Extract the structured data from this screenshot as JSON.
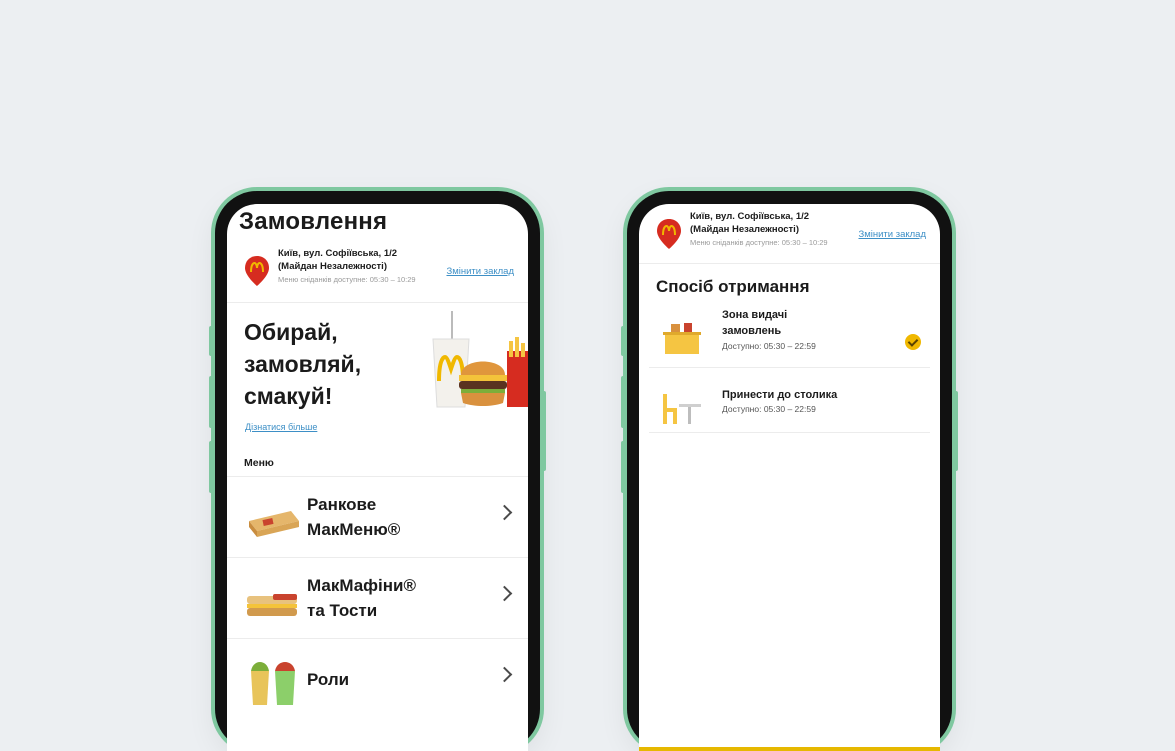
{
  "left_screen": {
    "title": "Замовлення",
    "store": {
      "name": "Київ, вул. Софіївська, 1/2 (Майдан Незалежності)",
      "note": "Меню сніданків доступне: 05:30 – 10:29",
      "change_link": "Змінити заклад"
    },
    "hero": {
      "line1": "Обирай,",
      "line2": "замовляй,",
      "line3": "смакуй!"
    },
    "learn_more": "Дізнатися більше",
    "menu_label": "Меню",
    "menu_items": [
      {
        "line1": "Ранкове",
        "line2": "МакМеню®",
        "icon": "breakfast-sandwich-icon"
      },
      {
        "line1": "МакМафіни®",
        "line2": "та Тости",
        "icon": "muffin-toast-icon"
      },
      {
        "line1": "Роли",
        "line2": "",
        "icon": "wraps-icon"
      }
    ]
  },
  "right_screen": {
    "store": {
      "name": "Київ, вул. Софіївська, 1/2 (Майдан Незалежності)",
      "note": "Меню сніданків доступне: 05:30 – 10:29",
      "change_link": "Змінити заклад"
    },
    "section_title": "Спосіб отримання",
    "options": [
      {
        "name": "Зона видачі замовлень",
        "hours": "Доступно: 05:30 – 22:59",
        "selected": true,
        "icon": "pickup-counter-icon"
      },
      {
        "name": "Принести до столика",
        "hours": "Доступно: 05:30 – 22:59",
        "selected": false,
        "icon": "table-service-icon"
      }
    ]
  },
  "colors": {
    "brand_red": "#d62c20",
    "brand_yellow": "#f0b800",
    "link_blue": "#3d8fc6",
    "frame_green": "#7fc8a0"
  }
}
